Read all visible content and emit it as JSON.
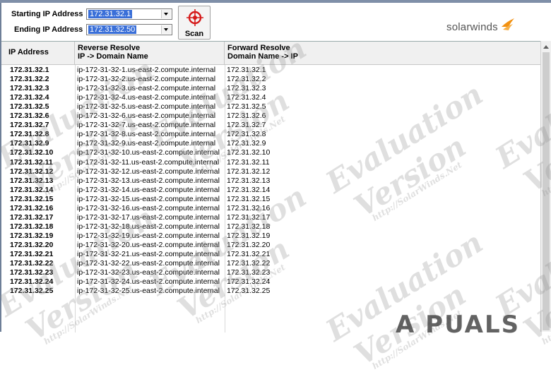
{
  "form": {
    "start_label": "Starting IP Address",
    "start_value": "172.31.32.1",
    "end_label": "Ending IP Address",
    "end_value": "172.31.32.50",
    "scan_label": "Scan"
  },
  "brand": {
    "logo_text": "solarwinds",
    "accent": "#f29111"
  },
  "table": {
    "headers": [
      {
        "line1": "IP Address",
        "line2": ""
      },
      {
        "line1": "Reverse Resolve",
        "line2": "IP -> Domain Name"
      },
      {
        "line1": "Forward Resolve",
        "line2": "Domain Name -> IP"
      }
    ],
    "rows": [
      {
        "ip": "172.31.32.1",
        "reverse": "ip-172-31-32-1.us-east-2.compute.internal",
        "forward": "172.31.32.1"
      },
      {
        "ip": "172.31.32.2",
        "reverse": "ip-172-31-32-2.us-east-2.compute.internal",
        "forward": "172.31.32.2"
      },
      {
        "ip": "172.31.32.3",
        "reverse": "ip-172-31-32-3.us-east-2.compute.internal",
        "forward": "172.31.32.3"
      },
      {
        "ip": "172.31.32.4",
        "reverse": "ip-172-31-32-4.us-east-2.compute.internal",
        "forward": "172.31.32.4"
      },
      {
        "ip": "172.31.32.5",
        "reverse": "ip-172-31-32-5.us-east-2.compute.internal",
        "forward": "172.31.32.5"
      },
      {
        "ip": "172.31.32.6",
        "reverse": "ip-172-31-32-6.us-east-2.compute.internal",
        "forward": "172.31.32.6"
      },
      {
        "ip": "172.31.32.7",
        "reverse": "ip-172-31-32-7.us-east-2.compute.internal",
        "forward": "172.31.32.7"
      },
      {
        "ip": "172.31.32.8",
        "reverse": "ip-172-31-32-8.us-east-2.compute.internal",
        "forward": "172.31.32.8"
      },
      {
        "ip": "172.31.32.9",
        "reverse": "ip-172-31-32-9.us-east-2.compute.internal",
        "forward": "172.31.32.9"
      },
      {
        "ip": "172.31.32.10",
        "reverse": "ip-172-31-32-10.us-east-2.compute.internal",
        "forward": "172.31.32.10"
      },
      {
        "ip": "172.31.32.11",
        "reverse": "ip-172-31-32-11.us-east-2.compute.internal",
        "forward": "172.31.32.11"
      },
      {
        "ip": "172.31.32.12",
        "reverse": "ip-172-31-32-12.us-east-2.compute.internal",
        "forward": "172.31.32.12"
      },
      {
        "ip": "172.31.32.13",
        "reverse": "ip-172-31-32-13.us-east-2.compute.internal",
        "forward": "172.31.32.13"
      },
      {
        "ip": "172.31.32.14",
        "reverse": "ip-172-31-32-14.us-east-2.compute.internal",
        "forward": "172.31.32.14"
      },
      {
        "ip": "172.31.32.15",
        "reverse": "ip-172-31-32-15.us-east-2.compute.internal",
        "forward": "172.31.32.15"
      },
      {
        "ip": "172.31.32.16",
        "reverse": "ip-172-31-32-16.us-east-2.compute.internal",
        "forward": "172.31.32.16"
      },
      {
        "ip": "172.31.32.17",
        "reverse": "ip-172-31-32-17.us-east-2.compute.internal",
        "forward": "172.31.32.17"
      },
      {
        "ip": "172.31.32.18",
        "reverse": "ip-172-31-32-18.us-east-2.compute.internal",
        "forward": "172.31.32.18"
      },
      {
        "ip": "172.31.32.19",
        "reverse": "ip-172-31-32-19.us-east-2.compute.internal",
        "forward": "172.31.32.19"
      },
      {
        "ip": "172.31.32.20",
        "reverse": "ip-172-31-32-20.us-east-2.compute.internal",
        "forward": "172.31.32.20"
      },
      {
        "ip": "172.31.32.21",
        "reverse": "ip-172-31-32-21.us-east-2.compute.internal",
        "forward": "172.31.32.21"
      },
      {
        "ip": "172.31.32.22",
        "reverse": "ip-172-31-32-22.us-east-2.compute.internal",
        "forward": "172.31.32.22"
      },
      {
        "ip": "172.31.32.23",
        "reverse": "ip-172-31-32-23.us-east-2.compute.internal",
        "forward": "172.31.32.23"
      },
      {
        "ip": "172.31.32.24",
        "reverse": "ip-172-31-32-24.us-east-2.compute.internal",
        "forward": "172.31.32.24"
      },
      {
        "ip": "172.31.32.25",
        "reverse": "ip-172-31-32-25.us-east-2.compute.internal",
        "forward": "172.31.32.25"
      }
    ]
  },
  "watermark": {
    "line1": "Evaluation",
    "line2": "Version",
    "url": "http://SolarWinds.Net"
  },
  "overlay": {
    "site_mark": "A PUALS"
  }
}
